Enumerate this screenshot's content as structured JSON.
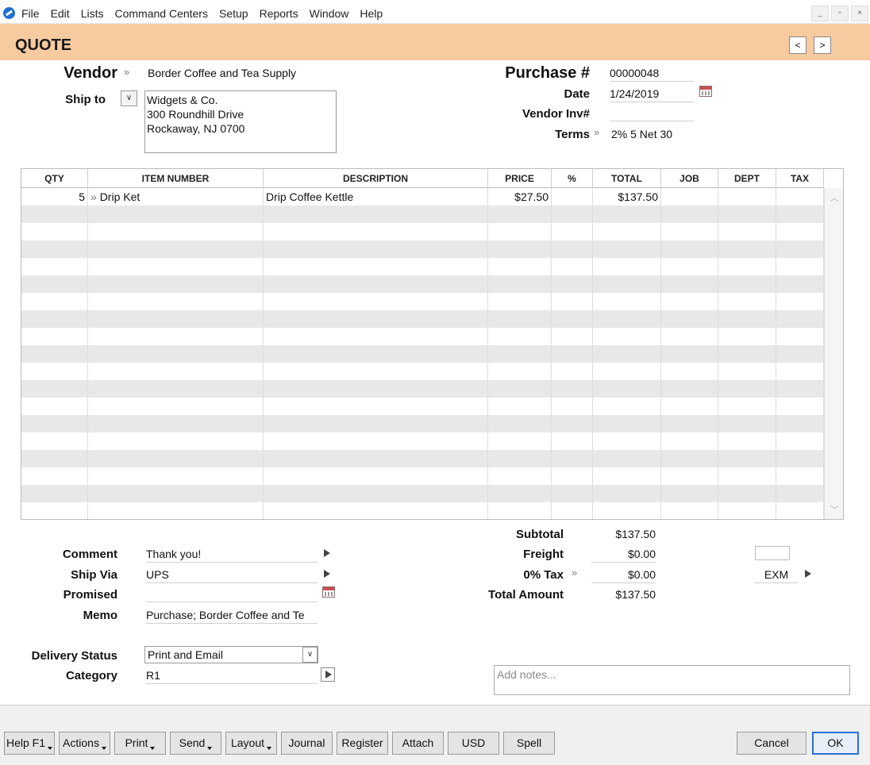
{
  "menu": [
    "File",
    "Edit",
    "Lists",
    "Command Centers",
    "Setup",
    "Reports",
    "Window",
    "Help"
  ],
  "window_controls": {
    "minimize": "_",
    "restore": "▫",
    "close": "×"
  },
  "title": "QUOTE",
  "nav": {
    "prev": "<",
    "next": ">"
  },
  "header": {
    "vendor_label": "Vendor",
    "vendor_value": "Border Coffee and Tea Supply",
    "shipto_label": "Ship to",
    "shipto_lines": [
      "Widgets & Co.",
      "300 Roundhill Drive",
      "Rockaway, NJ 0700"
    ],
    "purchase_label": "Purchase #",
    "purchase_value": "00000048",
    "date_label": "Date",
    "date_value": "1/24/2019",
    "vendor_inv_label": "Vendor Inv#",
    "vendor_inv_value": "",
    "terms_label": "Terms",
    "terms_value": "2% 5 Net 30"
  },
  "grid": {
    "columns": [
      "QTY",
      "ITEM NUMBER",
      "DESCRIPTION",
      "PRICE",
      "%",
      "TOTAL",
      "JOB",
      "DEPT",
      "TAX"
    ],
    "rows": [
      {
        "qty": "5",
        "item": "Drip Ket",
        "description": "Drip Coffee Kettle",
        "price": "$27.50",
        "pct": "",
        "total": "$137.50",
        "job": "",
        "dept": "",
        "tax": ""
      }
    ],
    "empty_rows": 18
  },
  "left_fields": {
    "comment_label": "Comment",
    "comment_value": "Thank you!",
    "shipvia_label": "Ship Via",
    "shipvia_value": "UPS",
    "promised_label": "Promised",
    "promised_value": "",
    "memo_label": "Memo",
    "memo_value": "Purchase; Border Coffee and Te",
    "delivery_label": "Delivery Status",
    "delivery_value": "Print and Email",
    "category_label": "Category",
    "category_value": "R1"
  },
  "totals": {
    "subtotal_label": "Subtotal",
    "subtotal_value": "$137.50",
    "freight_label": "Freight",
    "freight_value": "$0.00",
    "tax_label": "0% Tax",
    "tax_value": "$0.00",
    "tax_code": "EXM",
    "total_label": "Total Amount",
    "total_value": "$137.50"
  },
  "notes_placeholder": "Add notes...",
  "buttons": {
    "help": "Help F1",
    "actions": "Actions",
    "print": "Print",
    "send": "Send",
    "layout": "Layout",
    "journal": "Journal",
    "register": "Register",
    "attach": "Attach",
    "currency": "USD",
    "spell": "Spell",
    "cancel": "Cancel",
    "ok": "OK"
  },
  "colors": {
    "title_bar": "#f8caa0",
    "ok_border": "#2a6fd6",
    "row_alt": "#e8e8e8"
  }
}
